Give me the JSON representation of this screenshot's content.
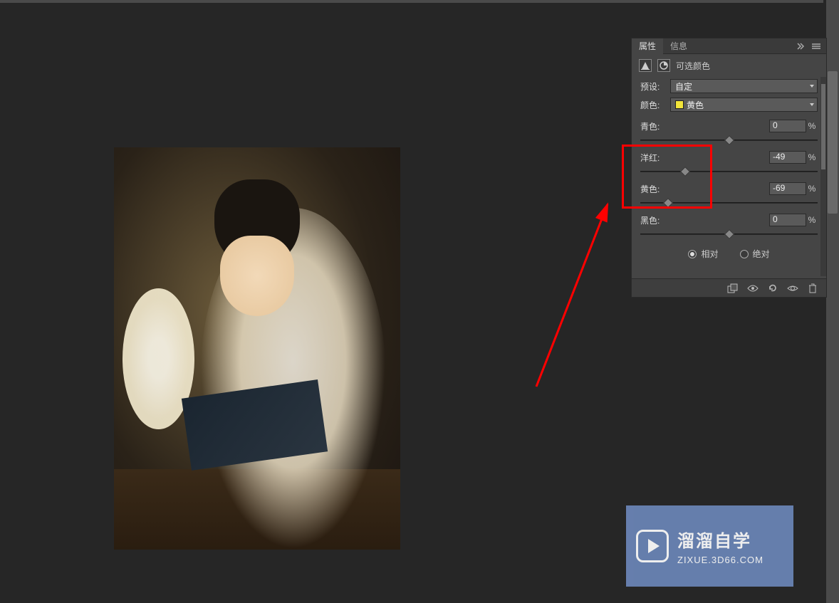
{
  "panel": {
    "tabs": {
      "properties": "属性",
      "info": "信息"
    },
    "adjustment_name": "可选颜色",
    "preset_label": "预设:",
    "preset_value": "自定",
    "color_label": "颜色:",
    "color_value": "黄色",
    "color_swatch": "#f2e43a",
    "sliders": {
      "cyan": {
        "label": "青色:",
        "value": "0",
        "pct": "%",
        "pos": 50
      },
      "magenta": {
        "label": "洋红:",
        "value": "-49",
        "pct": "%",
        "pos": 25.5
      },
      "yellow": {
        "label": "黄色:",
        "value": "-69",
        "pct": "%",
        "pos": 15.5
      },
      "black": {
        "label": "黑色:",
        "value": "0",
        "pct": "%",
        "pos": 50
      }
    },
    "mode": {
      "relative": "相对",
      "absolute": "绝对",
      "selected": "relative"
    }
  },
  "watermark": {
    "title": "溜溜自学",
    "sub": "ZIXUE.3D66.COM"
  }
}
